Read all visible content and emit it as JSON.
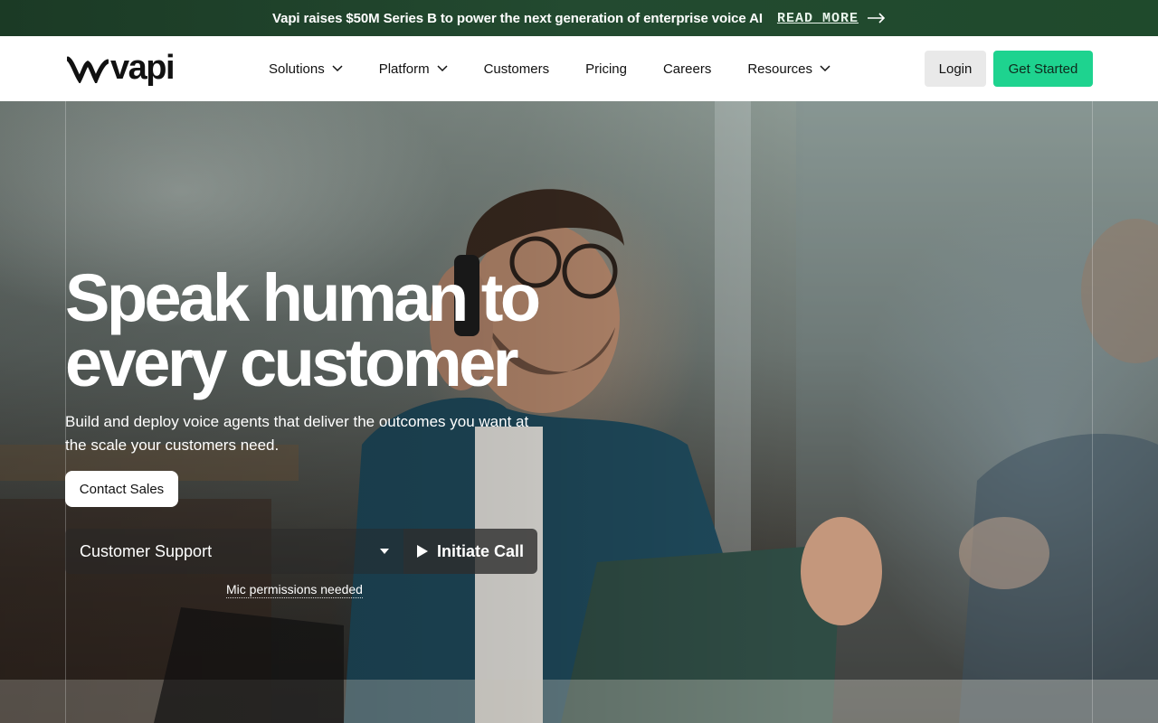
{
  "announcement": {
    "text": "Vapi raises $50M Series B to power the next generation of enterprise voice AI",
    "link_label": "READ MORE",
    "icon": "arrow-right-icon"
  },
  "nav": {
    "logo_text": "vapi",
    "items": [
      {
        "label": "Solutions",
        "has_dropdown": true
      },
      {
        "label": "Platform",
        "has_dropdown": true
      },
      {
        "label": "Customers",
        "has_dropdown": false
      },
      {
        "label": "Pricing",
        "has_dropdown": false
      },
      {
        "label": "Careers",
        "has_dropdown": false
      },
      {
        "label": "Resources",
        "has_dropdown": true
      }
    ],
    "login_label": "Login",
    "get_started_label": "Get Started"
  },
  "hero": {
    "title_line1": "Speak human to",
    "title_line2": "every customer",
    "subtitle": "Build and deploy voice agents that deliver the outcomes you want at the scale your customers need.",
    "contact_label": "Contact Sales",
    "agent_select_value": "Customer Support",
    "call_button_label": "Initiate Call",
    "mic_note": "Mic permissions needed"
  },
  "colors": {
    "announce_bg": "#1f4a2c",
    "brand_green": "#1ed38f",
    "login_bg": "#e9e9e9"
  }
}
